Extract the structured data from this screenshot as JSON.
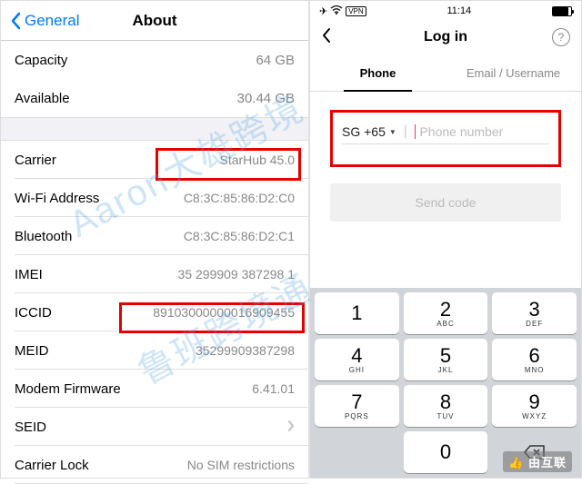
{
  "left": {
    "back_label": "General",
    "title": "About",
    "capacity": {
      "label": "Capacity",
      "value": "64 GB"
    },
    "available": {
      "label": "Available",
      "value": "30.44 GB"
    },
    "rows": [
      {
        "label": "Carrier",
        "value": "StarHub 45.0"
      },
      {
        "label": "Wi-Fi Address",
        "value": "C8:3C:85:86:D2:C0"
      },
      {
        "label": "Bluetooth",
        "value": "C8:3C:85:86:D2:C1"
      },
      {
        "label": "IMEI",
        "value": "35 299909 387298 1"
      },
      {
        "label": "ICCID",
        "value": "89103000000016909455"
      },
      {
        "label": "MEID",
        "value": "35299909387298"
      },
      {
        "label": "Modem Firmware",
        "value": "6.41.01"
      },
      {
        "label": "SEID",
        "value": ""
      },
      {
        "label": "Carrier Lock",
        "value": "No SIM restrictions"
      }
    ]
  },
  "right": {
    "status": {
      "vpn": "VPN",
      "time": "11:14"
    },
    "login_title": "Log in",
    "tabs": {
      "phone": "Phone",
      "email": "Email / Username"
    },
    "country_code": "SG +65",
    "phone_placeholder": "Phone number",
    "send_code": "Send code",
    "keypad": [
      [
        {
          "d": "1",
          "l": ""
        },
        {
          "d": "2",
          "l": "ABC"
        },
        {
          "d": "3",
          "l": "DEF"
        }
      ],
      [
        {
          "d": "4",
          "l": "GHI"
        },
        {
          "d": "5",
          "l": "JKL"
        },
        {
          "d": "6",
          "l": "MNO"
        }
      ],
      [
        {
          "d": "7",
          "l": "PQRS"
        },
        {
          "d": "8",
          "l": "TUV"
        },
        {
          "d": "9",
          "l": "WXYZ"
        }
      ],
      [
        {
          "d": "",
          "l": "",
          "blank": true
        },
        {
          "d": "0",
          "l": ""
        },
        {
          "d": "",
          "l": "",
          "bksp": true
        }
      ]
    ]
  },
  "watermarks": {
    "wm1": "Aaron大雄跨境",
    "wm2": "鲁班跨境通",
    "logo": "👍 由互联"
  }
}
